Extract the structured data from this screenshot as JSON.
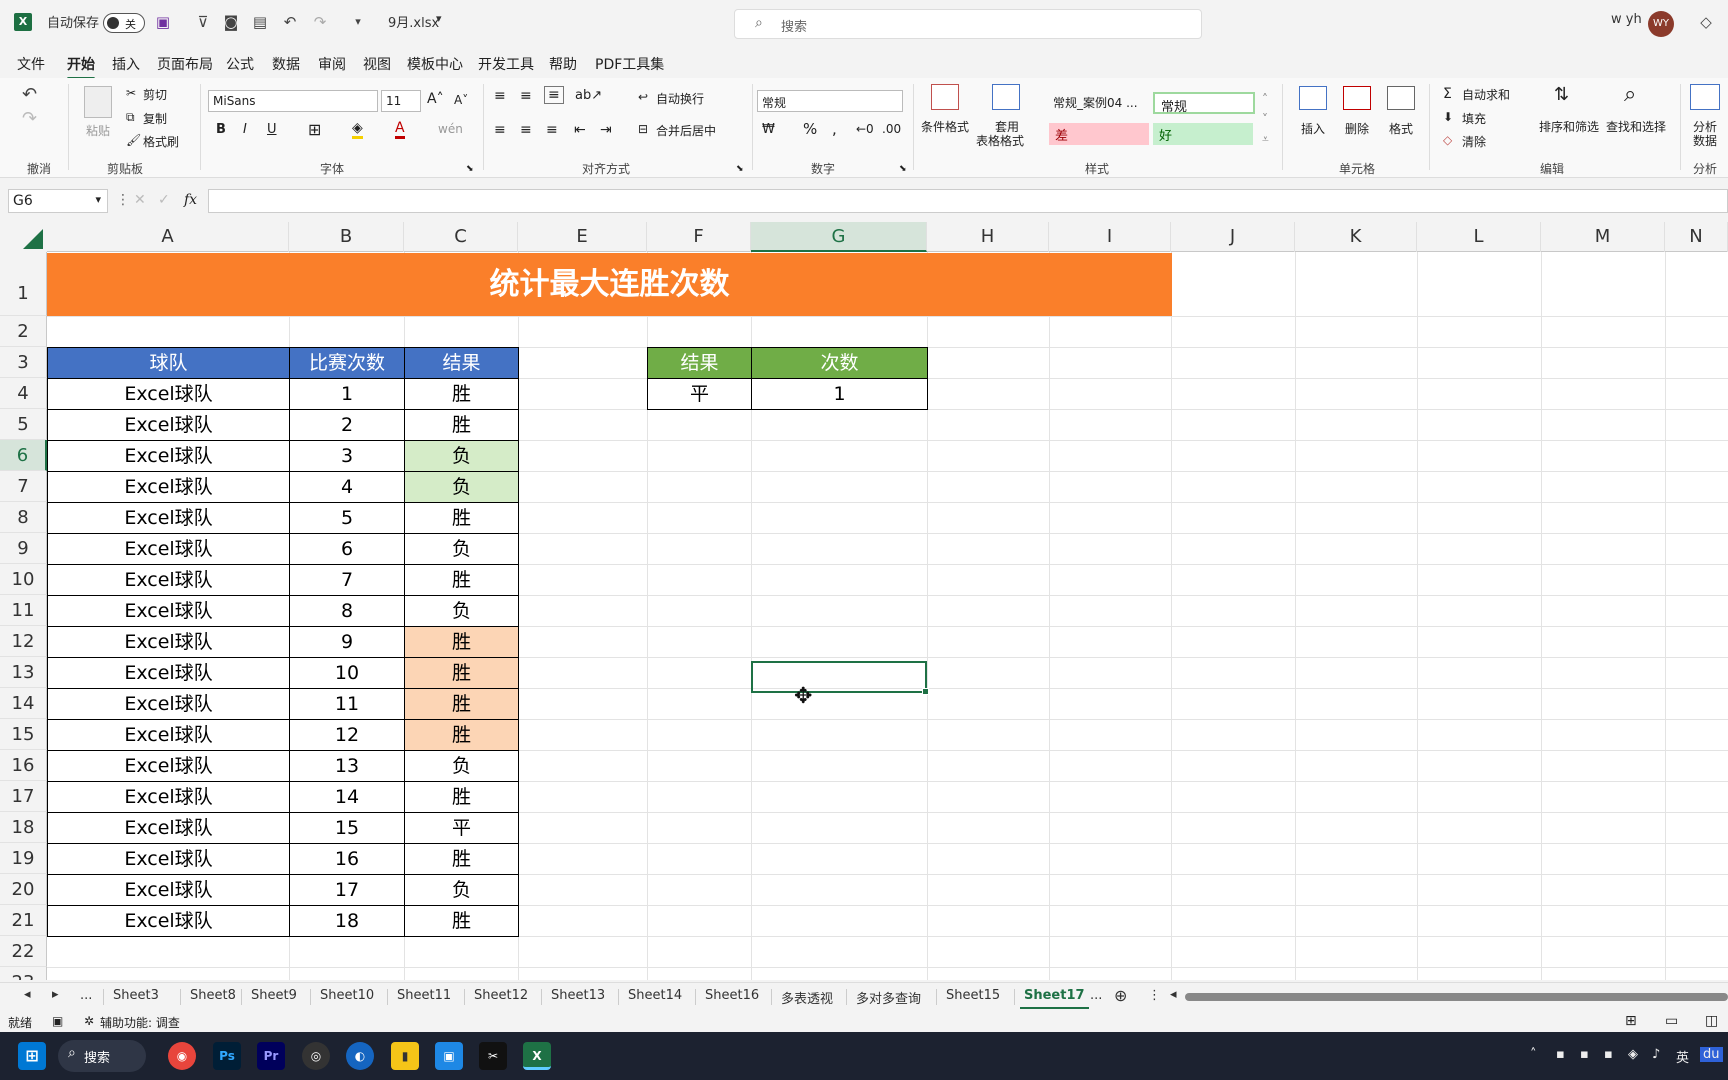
{
  "titlebar": {
    "autosave_label": "自动保存",
    "autosave_state": "关",
    "filename": "9月.xlsx",
    "search_placeholder": "搜索",
    "user_name": "w yh",
    "user_initials": "WY"
  },
  "menu": {
    "tabs": [
      "文件",
      "开始",
      "插入",
      "页面布局",
      "公式",
      "数据",
      "审阅",
      "视图",
      "模板中心",
      "开发工具",
      "帮助",
      "PDF工具集"
    ],
    "active": "开始"
  },
  "ribbon": {
    "undo_label": "撤消",
    "clipboard": {
      "paste": "粘贴",
      "cut": "剪切",
      "copy": "复制",
      "format_painter": "格式刷",
      "group": "剪贴板"
    },
    "font": {
      "name": "MiSans",
      "size": "11",
      "group": "字体",
      "bold": "B",
      "italic": "I",
      "underline": "U"
    },
    "alignment": {
      "wrap": "自动换行",
      "merge": "合并后居中",
      "group": "对齐方式"
    },
    "number": {
      "format": "常规",
      "group": "数字"
    },
    "styles": {
      "conditional": "条件格式",
      "table_format_1": "套用",
      "table_format_2": "表格格式",
      "cell_normal_case": "常规_案例04 ...",
      "cell_normal": "常规",
      "cell_bad": "差",
      "cell_good": "好",
      "group": "样式"
    },
    "cells": {
      "insert": "插入",
      "delete": "删除",
      "format": "格式",
      "group": "单元格"
    },
    "editing": {
      "autosum": "自动求和",
      "fill": "填充",
      "clear": "清除",
      "sort_filter": "排序和筛选",
      "find_select": "查找和选择",
      "group": "编辑"
    },
    "analysis": {
      "label_1": "分析",
      "label_2": "数据",
      "group": "分析"
    }
  },
  "formula_bar": {
    "name_box": "G6",
    "fx": "fx",
    "content": ""
  },
  "columns": [
    "A",
    "B",
    "C",
    "E",
    "F",
    "G",
    "H",
    "I",
    "J",
    "K",
    "L",
    "M",
    "N"
  ],
  "selected_column": "G",
  "rows": [
    "1",
    "2",
    "3",
    "4",
    "5",
    "6",
    "7",
    "8",
    "9",
    "10",
    "11",
    "12",
    "13",
    "14",
    "15",
    "16",
    "17",
    "18",
    "19",
    "20",
    "21",
    "22",
    "23"
  ],
  "selected_row": "6",
  "sheet": {
    "title": "统计最大连胜次数",
    "table_headers": [
      "球队",
      "比赛次数",
      "结果"
    ],
    "table_rows": [
      [
        "Excel球队",
        "1",
        "胜"
      ],
      [
        "Excel球队",
        "2",
        "胜"
      ],
      [
        "Excel球队",
        "3",
        "负"
      ],
      [
        "Excel球队",
        "4",
        "负"
      ],
      [
        "Excel球队",
        "5",
        "胜"
      ],
      [
        "Excel球队",
        "6",
        "负"
      ],
      [
        "Excel球队",
        "7",
        "胜"
      ],
      [
        "Excel球队",
        "8",
        "负"
      ],
      [
        "Excel球队",
        "9",
        "胜"
      ],
      [
        "Excel球队",
        "10",
        "胜"
      ],
      [
        "Excel球队",
        "11",
        "胜"
      ],
      [
        "Excel球队",
        "12",
        "胜"
      ],
      [
        "Excel球队",
        "13",
        "负"
      ],
      [
        "Excel球队",
        "14",
        "胜"
      ],
      [
        "Excel球队",
        "15",
        "平"
      ],
      [
        "Excel球队",
        "16",
        "胜"
      ],
      [
        "Excel球队",
        "17",
        "负"
      ],
      [
        "Excel球队",
        "18",
        "胜"
      ]
    ],
    "highlight_green_rows": [
      2,
      3
    ],
    "highlight_orange_rows": [
      8,
      9,
      10,
      11
    ],
    "summary_headers": [
      "结果",
      "次数"
    ],
    "summary_row": [
      "平",
      "1"
    ]
  },
  "colors": {
    "title_bg": "#FA7F2A",
    "blue_header": "#4472C4",
    "green_header": "#70AD47",
    "green_fill": "#D5ECC8",
    "orange_fill": "#FCD5B5",
    "excel_green": "#1E7145"
  },
  "sheet_tabs": [
    "...",
    "Sheet3",
    "Sheet8",
    "Sheet9",
    "Sheet10",
    "Sheet11",
    "Sheet12",
    "Sheet13",
    "Sheet14",
    "Sheet16",
    "多表透视",
    "多对多查询",
    "Sheet15",
    "Sheet17",
    "..."
  ],
  "active_sheet": "Sheet17",
  "status": {
    "ready": "就绪",
    "accessibility": "辅助功能: 调查"
  },
  "taskbar": {
    "search": "搜索",
    "lang": "英",
    "apps": [
      "chrome-icon",
      "photoshop-icon",
      "premiere-icon",
      "obs-icon",
      "browser-icon",
      "files-icon",
      "video-icon",
      "capcut-icon",
      "excel-icon"
    ]
  }
}
